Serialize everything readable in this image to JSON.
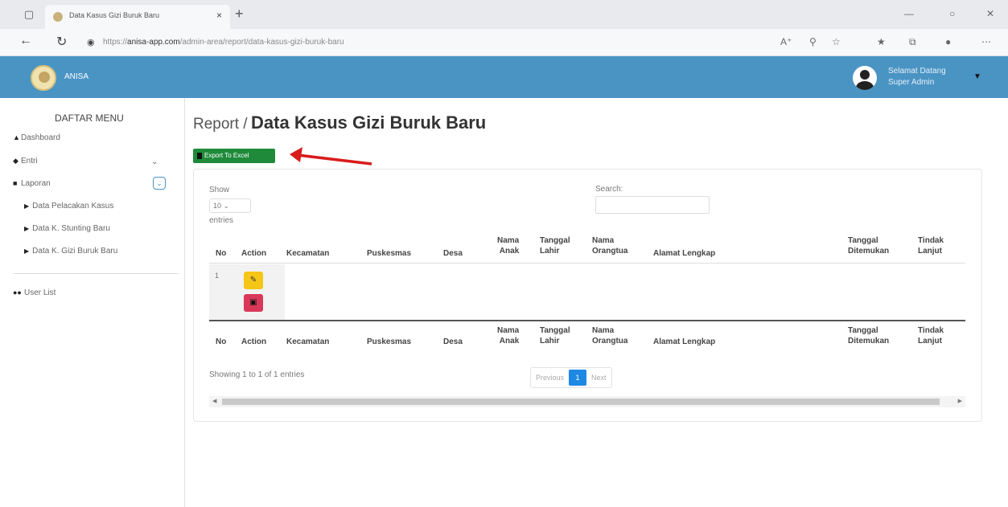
{
  "browser": {
    "tab_title": "Data Kasus Gizi Buruk Baru",
    "tab_close": "×",
    "new_tab": "+",
    "url_prefix": "https://",
    "url_host": "anisa-app.com",
    "url_path": "/admin-area/report/data-kasus-gizi-buruk-baru"
  },
  "header": {
    "brand": "ANISA",
    "greeting_line1": "Selamat Datang",
    "greeting_line2": "Super Admin",
    "accent": "#4a94c4"
  },
  "sidebar": {
    "title": "DAFTAR MENU",
    "items": [
      {
        "label": "Dashboard",
        "icon": "home-icon"
      },
      {
        "label": "Entri",
        "icon": "tag-icon"
      },
      {
        "label": "Laporan",
        "icon": "book-icon"
      }
    ],
    "sub_items": [
      {
        "label": "Data Pelacakan Kasus"
      },
      {
        "label": "Data K. Stunting Baru"
      },
      {
        "label": "Data K. Gizi Buruk Baru"
      }
    ],
    "user_list": "User List"
  },
  "page": {
    "crumb": "Report /",
    "title": "Data Kasus Gizi Buruk Baru",
    "export_label": "Export To Excel"
  },
  "table": {
    "show_label": "Show",
    "length_value": "10",
    "entries_label": "entries",
    "search_label": "Search:",
    "columns": {
      "no": "No",
      "action": "Action",
      "kecamatan": "Kecamatan",
      "puskesmas": "Puskesmas",
      "desa": "Desa",
      "nama_anak_1": "Nama",
      "nama_anak_2": "Anak",
      "tgl_lahir_1": "Tanggal",
      "tgl_lahir_2": "Lahir",
      "nama_ortu_1": "Nama",
      "nama_ortu_2": "Orangtua",
      "alamat": "Alamat Lengkap",
      "tgl_ditemukan_1": "Tanggal",
      "tgl_ditemukan_2": "Ditemukan",
      "tindak_1": "Tindak",
      "tindak_2": "Lanjut"
    },
    "rows": [
      {
        "no": "1"
      }
    ],
    "info": "Showing 1 to 1 of 1 entries",
    "previous": "Previous",
    "current_page": "1",
    "next": "Next"
  }
}
